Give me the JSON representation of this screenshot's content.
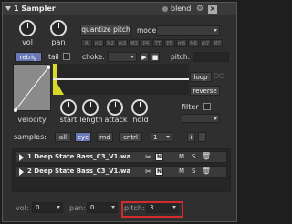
{
  "title": "1 Sampler",
  "blend_label": "blend",
  "knobs": {
    "vol": "vol",
    "pan": "pan"
  },
  "quantize_label": "quantize pitch",
  "mode_label": "mode:",
  "notes": [
    "R",
    "m2",
    "M2",
    "m3",
    "M3",
    "P4",
    "TT",
    "P5",
    "m6",
    "M6",
    "m7",
    "M7"
  ],
  "retrig_label": "retrig",
  "tail_label": "tail",
  "choke_label": "choke:",
  "pitch_top_label": "pitch:",
  "loop_label": "loop",
  "reverse_label": "reverse",
  "filter_label": "filter",
  "env_knobs": [
    "velocity",
    "start",
    "length",
    "attack",
    "hold"
  ],
  "samples_label": "samples:",
  "sample_tabs": [
    "all",
    "cyc",
    "rnd",
    "cntrl"
  ],
  "sample_count": "1",
  "samples": [
    {
      "name": "1 Deep State Bass_C3_V1.wa"
    },
    {
      "name": "2 Deep State Bass_C3_V1.wa"
    }
  ],
  "row_buttons": {
    "n": "N",
    "m": "M",
    "s": "S"
  },
  "bottom": {
    "vol_label": "vol:",
    "vol_value": "0",
    "pan_label": "pan:",
    "pan_value": "0",
    "pitch_label": "pitch:",
    "pitch_value": "3"
  },
  "colors": {
    "accent": "#6a79b5",
    "highlight": "#d12b2b",
    "waveform": "#d9d92a"
  }
}
